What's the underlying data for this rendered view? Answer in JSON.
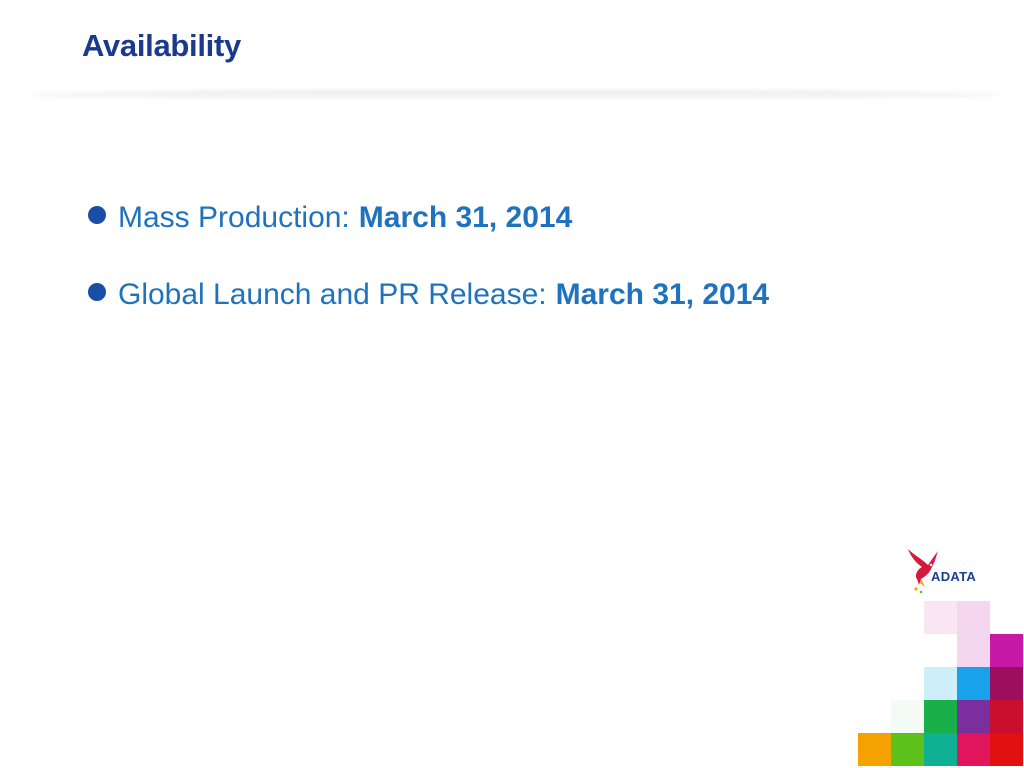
{
  "slide": {
    "title": "Availability"
  },
  "bullets": [
    {
      "label": "Mass Production:",
      "value": "March 31, 2014"
    },
    {
      "label": "Global Launch and PR Release:",
      "value": "March 31, 2014"
    }
  ],
  "logo": {
    "text": "ADATA",
    "icon": "hummingbird-logo-icon"
  },
  "colors": {
    "title": "#1b3a8c",
    "bullet_text": "#1f72bd",
    "bullet_dot": "#1a4da8",
    "mosaic": [
      "#f9e6f3",
      "#f4d7ee",
      "#c718a6",
      "#eef9fd",
      "#cdeffa",
      "#17a2ea",
      "#9b0f5e",
      "#f4fbf6",
      "#19b04a",
      "#7b2f9e",
      "#c8102e",
      "#f5a100",
      "#5cc21a",
      "#10b095",
      "#e0155b",
      "#e21010"
    ]
  }
}
